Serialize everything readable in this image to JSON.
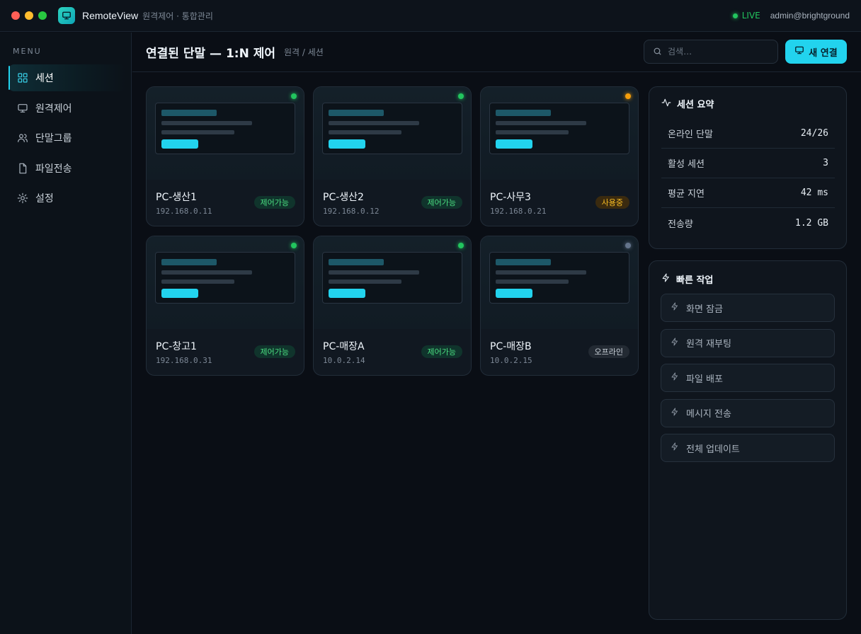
{
  "titlebar": {
    "app_name": "RemoteView",
    "app_subtitle": "원격제어 · 통합관리",
    "live_label": "LIVE",
    "user": "admin@brightground"
  },
  "sidebar": {
    "menu_label": "MENU",
    "items": [
      {
        "label": "세션",
        "icon": "grid-icon",
        "active": true
      },
      {
        "label": "원격제어",
        "icon": "monitor-icon"
      },
      {
        "label": "단말그룹",
        "icon": "users-icon"
      },
      {
        "label": "파일전송",
        "icon": "file-icon"
      },
      {
        "label": "설정",
        "icon": "gear-icon"
      }
    ]
  },
  "header": {
    "title": "연결된 단말 — 1:N 제어",
    "breadcrumb": "원격 / 세션",
    "search_placeholder": "검색…",
    "new_button": "새 연결"
  },
  "devices": [
    {
      "name": "PC-생산1",
      "ip": "192.168.0.11",
      "status": "제어가능",
      "dot_color": "#22c55e",
      "badge_bg": "#10342c",
      "badge_fg": "#4ade80"
    },
    {
      "name": "PC-생산2",
      "ip": "192.168.0.12",
      "status": "제어가능",
      "dot_color": "#22c55e",
      "badge_bg": "#10342c",
      "badge_fg": "#4ade80"
    },
    {
      "name": "PC-사무3",
      "ip": "192.168.0.21",
      "status": "사용중",
      "dot_color": "#f59e0b",
      "badge_bg": "#3a2a0f",
      "badge_fg": "#fbbf24"
    },
    {
      "name": "PC-창고1",
      "ip": "192.168.0.31",
      "status": "제어가능",
      "dot_color": "#22c55e",
      "badge_bg": "#10342c",
      "badge_fg": "#4ade80"
    },
    {
      "name": "PC-매장A",
      "ip": "10.0.2.14",
      "status": "제어가능",
      "dot_color": "#22c55e",
      "badge_bg": "#10342c",
      "badge_fg": "#4ade80"
    },
    {
      "name": "PC-매장B",
      "ip": "10.0.2.15",
      "status": "오프라인",
      "dot_color": "#64748b",
      "badge_bg": "#232a33",
      "badge_fg": "#c9d1d9"
    }
  ],
  "summary": {
    "title": "세션 요약",
    "rows": [
      {
        "label": "온라인 단말",
        "value": "24/26"
      },
      {
        "label": "활성 세션",
        "value": "3"
      },
      {
        "label": "평균 지연",
        "value": "42 ms"
      },
      {
        "label": "전송량",
        "value": "1.2 GB"
      }
    ]
  },
  "quick_actions": {
    "title": "빠른 작업",
    "items": [
      "화면 잠금",
      "원격 재부팅",
      "파일 배포",
      "메시지 전송",
      "전체 업데이트"
    ]
  }
}
